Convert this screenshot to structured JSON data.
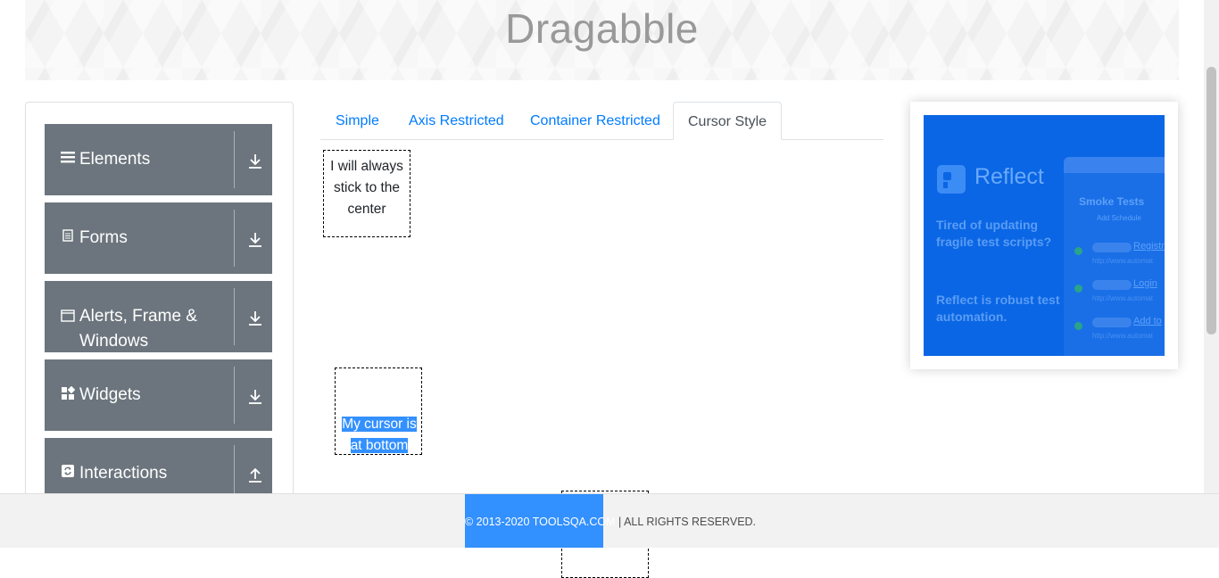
{
  "page": {
    "title": "Dragabble"
  },
  "sidebar": {
    "groups": [
      {
        "label": "Elements",
        "icon": "hamburger-icon",
        "arrow": "download-icon"
      },
      {
        "label": "Forms",
        "icon": "document-icon",
        "arrow": "download-icon"
      },
      {
        "label": "Alerts, Frame & Windows",
        "icon": "window-icon",
        "arrow": "download-icon"
      },
      {
        "label": "Widgets",
        "icon": "widgets-icon",
        "arrow": "download-icon"
      },
      {
        "label": "Interactions",
        "icon": "sync-icon",
        "arrow": "upload-icon"
      }
    ]
  },
  "tabs": [
    {
      "label": "Simple",
      "active": false
    },
    {
      "label": "Axis Restricted",
      "active": false
    },
    {
      "label": "Container Restricted",
      "active": false
    },
    {
      "label": "Cursor Style",
      "active": true
    }
  ],
  "cursor_style": {
    "center_box": "I will always stick to the center",
    "bottom_box": "My cursor is at bottom"
  },
  "ad": {
    "brand": "Reflect",
    "tagline": "Tired of updating fragile test scripts?",
    "tagline2": "Reflect is robust test automation.",
    "mock_title": "Smoke Tests",
    "mock_sub": "Add Schedule",
    "rows": [
      {
        "name": "Registr",
        "url": "http://www.automat"
      },
      {
        "name": "Login",
        "url": "http://www.automat"
      },
      {
        "name": "Add to",
        "url": "http://www.automat"
      }
    ]
  },
  "footer": {
    "highlighted": "© 2013-2020 TOOLSQA.COM",
    "rest": " | ALL RIGHTS RESERVED."
  },
  "colors": {
    "group_bg": "#6c757d",
    "link": "#007bff",
    "selection": "#3390ff",
    "ad_bg": "#0a66e4"
  }
}
